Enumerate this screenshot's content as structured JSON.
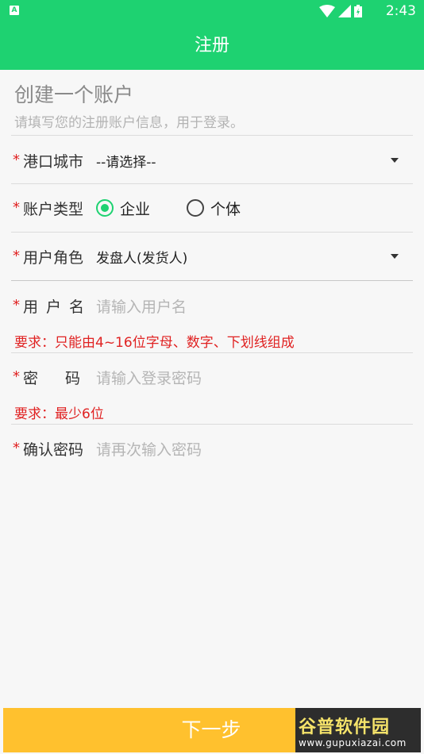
{
  "statusbar": {
    "time": "2:43",
    "notification_icon": "A"
  },
  "appbar": {
    "title": "注册"
  },
  "header": {
    "title": "创建一个账户",
    "subtitle": "请填写您的注册账户信息，用于登录。"
  },
  "required_mark": "*",
  "form": {
    "port_city": {
      "label": "港口城市",
      "value": "--请选择--"
    },
    "account_type": {
      "label": "账户类型",
      "options": [
        {
          "label": "企业",
          "checked": true
        },
        {
          "label": "个体",
          "checked": false
        }
      ]
    },
    "user_role": {
      "label": "用户角色",
      "value": "发盘人(发货人)"
    },
    "username": {
      "label": "用户名",
      "placeholder": "请输入用户名",
      "hint": "要求：只能由4~16位字母、数字、下划线组成"
    },
    "password": {
      "label": "密码",
      "placeholder": "请输入登录密码",
      "hint": "要求：最少6位"
    },
    "confirm_password": {
      "label": "确认密码",
      "placeholder": "请再次输入密码"
    }
  },
  "next_button": {
    "label": "下一步"
  },
  "watermark": {
    "logo": "谷普软件园",
    "url": "www.gupuxiazai.com"
  },
  "colors": {
    "primary": "#1ed271",
    "button": "#ffc12e",
    "required": "#e02222"
  }
}
